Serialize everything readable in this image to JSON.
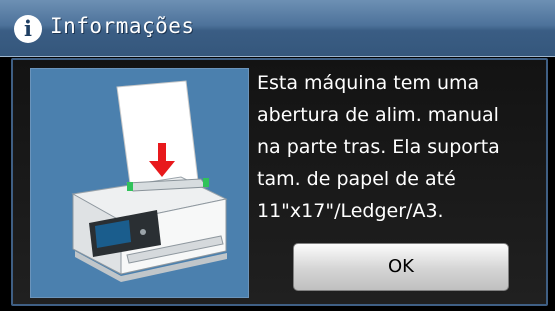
{
  "dialog": {
    "title": "Informações",
    "title_icon": "info-icon",
    "title_icon_glyph": "i",
    "message": "Esta máquina tem uma\nabertura de alim. manual\nna parte tras. Ela suporta\ntam. de papel de até\n11\"x17\"/Ledger/A3.",
    "ok_label": "OK",
    "illustration": "printer-manual-feed-slot-illustration"
  },
  "colors": {
    "titlebar": "#4d729a",
    "illustration_bg": "#4b80ae",
    "arrow": "#e8191c",
    "button": "#d4d4d4"
  }
}
